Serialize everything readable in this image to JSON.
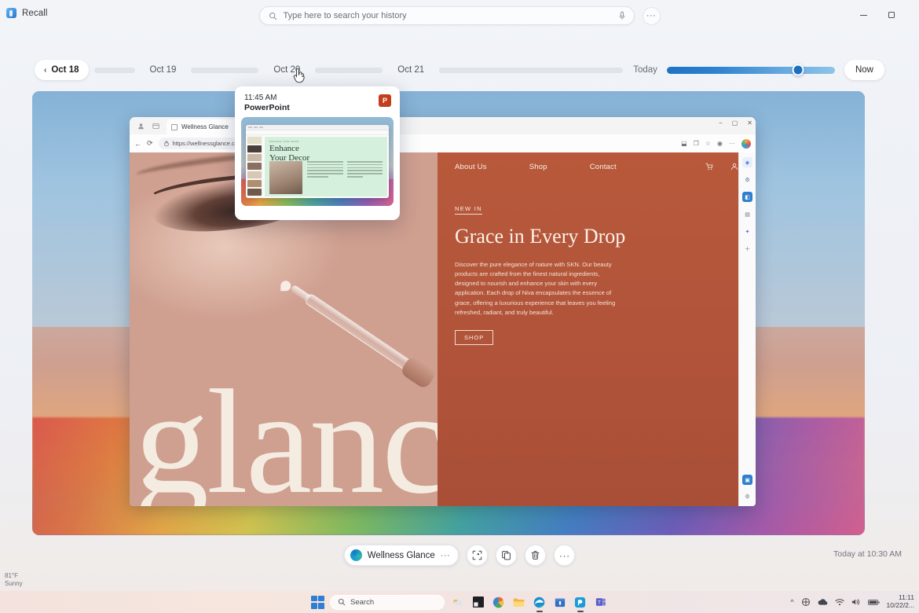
{
  "app": {
    "name": "Recall",
    "brand_icon": "recall-icon",
    "window_controls": {
      "minimize": "minimize-icon",
      "maximize": "maximize-icon"
    }
  },
  "search": {
    "placeholder": "Type here to search your history",
    "value": "",
    "search_icon": "search-icon",
    "mic_icon": "microphone-icon",
    "more_label": "···"
  },
  "timeline": {
    "back_chevron": "‹",
    "days": [
      {
        "label": "Oct 18",
        "active": true
      },
      {
        "label": "Oct 19",
        "active": false
      },
      {
        "label": "Oct 20",
        "active": false
      },
      {
        "label": "Oct 21",
        "active": false
      }
    ],
    "today_label": "Today",
    "now_label": "Now",
    "slider_position_pct": 78,
    "accent_color": "#1a6fc2"
  },
  "hover_card": {
    "time": "11:45 AM",
    "app": "PowerPoint",
    "app_icon": "powerpoint-icon",
    "app_icon_letter": "P",
    "app_icon_color": "#c43e1c",
    "preview": {
      "slide_kicker": "ENHANCE YOUR SPACE",
      "slide_title_line1": "Enhance",
      "slide_title_line2": "Your Decor"
    }
  },
  "snapshot": {
    "browser": {
      "tab_title": "Wellness Glance",
      "tab_close": "✕",
      "url": "https://wellnessglance.com",
      "back_icon": "back-arrow-icon",
      "reload_icon": "reload-icon",
      "lock_icon": "site-info-icon",
      "toolbar_icons": [
        "split-screen-icon",
        "collections-icon",
        "favorites-icon",
        "browser-essentials-icon",
        "settings-more-icon"
      ],
      "profile_icon": "profile-avatar",
      "window_controls": {
        "minimize": "−",
        "maximize": "▢",
        "close": "✕"
      }
    },
    "website": {
      "wordmark": "glance",
      "nav": [
        "About Us",
        "Shop",
        "Contact"
      ],
      "nav_icons": [
        "cart-icon",
        "account-icon"
      ],
      "eyebrow": "NEW IN",
      "title": "Grace in Every Drop",
      "body": "Discover the pure elegance of nature with SKN. Our beauty products are crafted from the finest natural ingredients, designed to nourish and enhance your skin with every application. Each drop of Niva encapsulates the essence of grace, offering a luxurious experience that leaves you feeling refreshed, radiant, and truly beautiful.",
      "cta": "SHOP",
      "brand_color": "#b5573a",
      "text_color": "#fbf0e8"
    },
    "sidebar_icons": [
      "copilot-icon",
      "settings-icon",
      "shopping-icon",
      "tools-icon",
      "games-icon",
      "add-icon"
    ]
  },
  "actionbar": {
    "app_label": "Wellness Glance",
    "app_icon": "edge-icon",
    "app_more": "···",
    "buttons": [
      {
        "name": "select-region-button",
        "icon": "crop-select-icon"
      },
      {
        "name": "copy-button",
        "icon": "copy-icon"
      },
      {
        "name": "delete-button",
        "icon": "trash-icon"
      },
      {
        "name": "more-options-button",
        "icon": "more-horizontal-icon"
      }
    ],
    "timestamp": "Today at 10:30 AM"
  },
  "weather": {
    "temp": "81°F",
    "condition": "Sunny"
  },
  "taskbar": {
    "start_label": "start-button",
    "search_placeholder": "Search",
    "search_icon": "search-icon",
    "apps": [
      {
        "name": "taskbar-app-weather",
        "icon": "weather-icon"
      },
      {
        "name": "taskbar-app-widgets",
        "icon": "widgets-icon"
      },
      {
        "name": "taskbar-app-photos",
        "icon": "photos-icon"
      },
      {
        "name": "taskbar-app-explorer",
        "icon": "file-explorer-icon"
      },
      {
        "name": "taskbar-app-edge",
        "icon": "edge-icon"
      },
      {
        "name": "taskbar-app-store",
        "icon": "store-icon"
      },
      {
        "name": "taskbar-app-recall",
        "icon": "recall-icon"
      },
      {
        "name": "taskbar-app-teams",
        "icon": "teams-icon"
      }
    ],
    "tray_icons": [
      "show-hidden-icons",
      "onedrive-icon",
      "cloud-icon",
      "wifi-icon",
      "volume-icon",
      "battery-icon"
    ],
    "clock_time": "11:11",
    "clock_date": "10/22/2..."
  }
}
